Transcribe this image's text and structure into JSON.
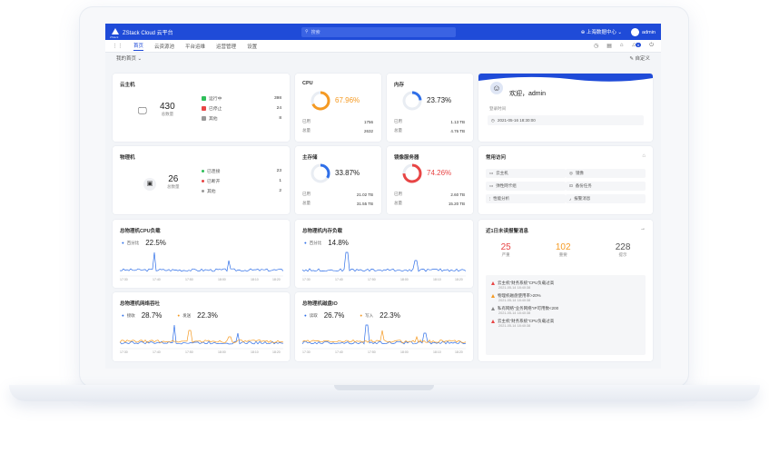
{
  "topbar": {
    "logo_sub": "ZStack",
    "title": "ZStack Cloud 云平台",
    "search_placeholder": "搜索",
    "zone": "上海数据中心",
    "user": "admin"
  },
  "nav": {
    "items": [
      {
        "label": "首页",
        "active": true
      },
      {
        "label": "云资源池",
        "active": false
      },
      {
        "label": "平台运维",
        "active": false
      },
      {
        "label": "运营管理",
        "active": false
      },
      {
        "label": "设置",
        "active": false
      }
    ],
    "badge": "6"
  },
  "subbar": {
    "view": "我的首页",
    "customize": "自定义"
  },
  "cloud_hosts": {
    "title": "云主机",
    "total": "430",
    "total_label": "总数量",
    "rows": [
      {
        "label": "运行中",
        "value": "398",
        "color": "#2fbf5a"
      },
      {
        "label": "已停止",
        "value": "24",
        "color": "#e84545"
      },
      {
        "label": "其他",
        "value": "8",
        "color": "#999999"
      }
    ]
  },
  "physical_hosts": {
    "title": "物理机",
    "total": "26",
    "total_label": "总数量",
    "rows": [
      {
        "label": "已连接",
        "value": "23",
        "color": "#2fbf5a"
      },
      {
        "label": "已断开",
        "value": "1",
        "color": "#e84545"
      },
      {
        "label": "其他",
        "value": "2",
        "color": "#999999"
      }
    ]
  },
  "cpu": {
    "title": "CPU",
    "percent": "67.96%",
    "fill": 0.6796,
    "color": "#f59a23",
    "used_label": "已用",
    "used": "1756",
    "total_label": "总量",
    "total": "2632"
  },
  "memory": {
    "title": "内存",
    "percent": "23.73%",
    "fill": 0.2373,
    "color": "#2f6fe8",
    "used_label": "已用",
    "used": "1.13 TB",
    "total_label": "总量",
    "total": "4.76 TB"
  },
  "primary_storage": {
    "title": "主存储",
    "percent": "33.87%",
    "fill": 0.3387,
    "color": "#2f6fe8",
    "used_label": "已用",
    "used": "21.02 TB",
    "total_label": "总量",
    "total": "31.55 TB"
  },
  "image_storage": {
    "title": "镜像服务器",
    "percent": "74.26%",
    "fill": 0.7426,
    "color": "#e84545",
    "used_label": "已用",
    "used": "2.60 TB",
    "total_label": "总量",
    "total": "15.20 TB"
  },
  "welcome": {
    "greeting": "欢迎，admin",
    "login_label": "登录时间",
    "login_time": "2021-05-16 18:30:00"
  },
  "quick": {
    "title": "常用访问",
    "items": [
      "云主机",
      "镜像",
      "弹性网卡组",
      "备份任务",
      "性能分析",
      "报警消息"
    ]
  },
  "cpu_chart": {
    "title": "总物理机CPU负载",
    "series": [
      {
        "name": "百分比",
        "value": "22.5%",
        "color": "#2f6fe8"
      }
    ],
    "ticks": [
      "17:30",
      "17:40",
      "17:50",
      "18:00",
      "18:10",
      "18:20"
    ]
  },
  "mem_chart": {
    "title": "总物理机内存负载",
    "series": [
      {
        "name": "百分比",
        "value": "14.8%",
        "color": "#2f6fe8"
      }
    ],
    "ticks": [
      "17:30",
      "17:40",
      "17:50",
      "18:00",
      "18:10",
      "18:20"
    ]
  },
  "net_chart": {
    "title": "总物理机网络吞吐",
    "series": [
      {
        "name": "接收",
        "value": "28.7%",
        "color": "#2f6fe8"
      },
      {
        "name": "发送",
        "value": "22.3%",
        "color": "#f59a23"
      }
    ],
    "ticks": [
      "17:30",
      "17:40",
      "17:50",
      "18:00",
      "18:10",
      "18:20"
    ]
  },
  "disk_chart": {
    "title": "总物理机磁盘IO",
    "series": [
      {
        "name": "读取",
        "value": "26.7%",
        "color": "#2f6fe8"
      },
      {
        "name": "写入",
        "value": "22.3%",
        "color": "#f59a23"
      }
    ],
    "ticks": [
      "17:30",
      "17:40",
      "17:50",
      "18:00",
      "18:10",
      "18:20"
    ]
  },
  "alerts": {
    "title": "近1日未读报警消息",
    "counts": [
      {
        "value": "25",
        "label": "严重",
        "color": "#e84545"
      },
      {
        "value": "102",
        "label": "重要",
        "color": "#f59a23"
      },
      {
        "value": "228",
        "label": "提示",
        "color": "#555555"
      }
    ],
    "items": [
      {
        "text": "云主机\"财务系统\"CPU负载过高",
        "time": "2021-05-14 18:40:38",
        "color": "#e84545"
      },
      {
        "text": "物理机磁盘使用率>20%",
        "time": "2021-05-14 18:40:38",
        "color": "#f59a23"
      },
      {
        "text": "私有网络\"业务网络\"IP可用数<200",
        "time": "2021-05-14 18:40:38",
        "color": "#888888"
      },
      {
        "text": "云主机\"财务系统\"CPU负载过高",
        "time": "2021-05-14 18:40:38",
        "color": "#e84545"
      }
    ]
  }
}
